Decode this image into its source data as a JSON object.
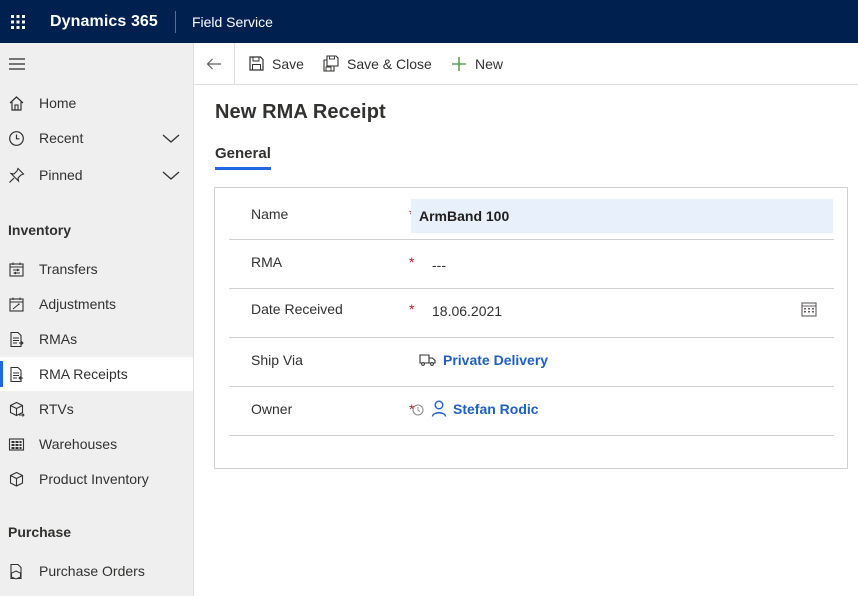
{
  "topbar": {
    "app_title": "Dynamics 365",
    "module_title": "Field Service",
    "bg_color": "#002050"
  },
  "sidebar": {
    "top_items": [
      {
        "label": "Home",
        "icon": "home-icon"
      },
      {
        "label": "Recent",
        "icon": "clock-icon"
      },
      {
        "label": "Pinned",
        "icon": "pin-icon"
      }
    ],
    "sections": [
      {
        "header": "Inventory",
        "items": [
          {
            "label": "Transfers",
            "icon": "transfer-icon"
          },
          {
            "label": "Adjustments",
            "icon": "adjustment-icon"
          },
          {
            "label": "RMAs",
            "icon": "document-icon"
          },
          {
            "label": "RMA Receipts",
            "icon": "receipt-icon",
            "active": true
          },
          {
            "label": "RTVs",
            "icon": "box-return-icon"
          },
          {
            "label": "Warehouses",
            "icon": "warehouse-icon"
          },
          {
            "label": "Product Inventory",
            "icon": "cube-icon"
          }
        ]
      },
      {
        "header": "Purchase",
        "items": [
          {
            "label": "Purchase Orders",
            "icon": "purchase-order-icon"
          }
        ]
      }
    ]
  },
  "commandbar": {
    "save_label": "Save",
    "save_close_label": "Save & Close",
    "new_label": "New"
  },
  "form": {
    "title": "New RMA Receipt",
    "tab_general": "General",
    "fields": {
      "name": {
        "label": "Name",
        "required": "*",
        "value": "ArmBand 100"
      },
      "rma": {
        "label": "RMA",
        "required": "*",
        "value": "---"
      },
      "date_received": {
        "label": "Date Received",
        "required": "*",
        "value": "18.06.2021"
      },
      "ship_via": {
        "label": "Ship Via",
        "value": "Private Delivery"
      },
      "owner": {
        "label": "Owner",
        "required": "*",
        "value": "Stefan Rodic"
      }
    }
  },
  "colors": {
    "accent": "#2266e3",
    "link": "#1f5fbd",
    "required": "#a4262c",
    "input_bg": "#e8f0fc"
  }
}
